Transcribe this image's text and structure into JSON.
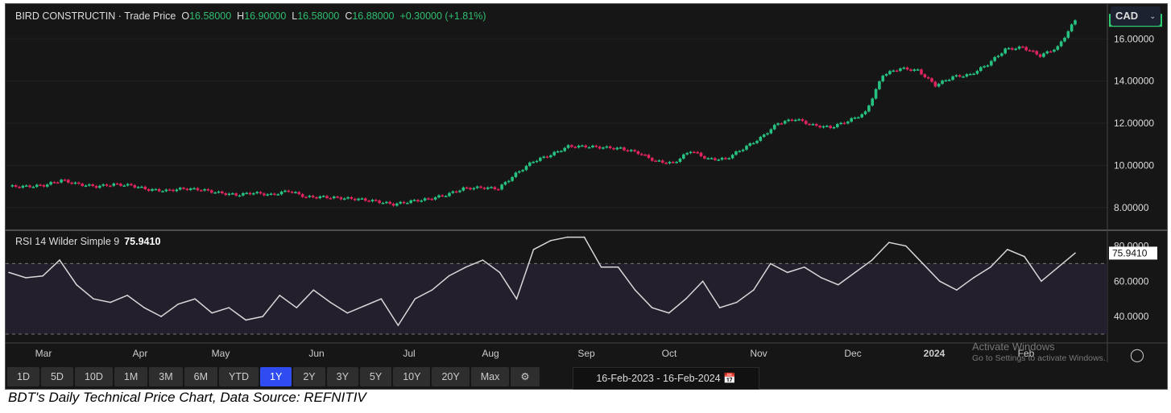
{
  "header": {
    "symbol": "BIRD CONSTRUCTIN",
    "sep": "·",
    "series": "Trade Price",
    "o_label": "O",
    "o": "16.58000",
    "h_label": "H",
    "h": "16.90000",
    "l_label": "L",
    "l": "16.58000",
    "c_label": "C",
    "c": "16.88000",
    "change": "+0.30000 (+1.81%)"
  },
  "currency": "CAD",
  "rsi_header": {
    "label": "RSI 14 Wilder Simple 9",
    "value": "75.9410"
  },
  "ranges": [
    "1D",
    "5D",
    "10D",
    "1M",
    "3M",
    "6M",
    "YTD",
    "1Y",
    "2Y",
    "3Y",
    "5Y",
    "10Y",
    "20Y",
    "Max"
  ],
  "active_range": "1Y",
  "date_range": {
    "from": "16-Feb-2023",
    "sep": "-",
    "to": "16-Feb-2024"
  },
  "watermark": {
    "line1": "Activate Windows",
    "line2": "Go to Settings to activate Windows."
  },
  "caption": "BDT's Daily Technical Price Chart, Data Source: REFNITIV",
  "colors": {
    "up": "#26c281",
    "down": "#e0245e",
    "rsi": "#d8d8d8",
    "last_price_bg": "#2ecc71"
  },
  "chart_data": [
    {
      "type": "candlestick",
      "title": "BIRD CONSTRUCTIN - Trade Price",
      "ylim": [
        7,
        17.5
      ],
      "yticks": [
        "8.00000",
        "10.00000",
        "12.00000",
        "14.00000",
        "16.00000"
      ],
      "ytick_values": [
        8,
        10,
        12,
        14,
        16
      ],
      "last_price": "16.88000",
      "last_value": 16.88,
      "xticks": [
        "Mar",
        "Apr",
        "May",
        "Jun",
        "Jul",
        "Aug",
        "Sep",
        "Oct",
        "Nov",
        "Dec",
        "2024",
        "Feb"
      ],
      "weekly_close": [
        9.0,
        9.0,
        9.05,
        9.3,
        9.1,
        9.0,
        9.1,
        9.05,
        8.85,
        8.8,
        8.9,
        8.85,
        8.7,
        8.6,
        8.7,
        8.6,
        8.8,
        8.5,
        8.5,
        8.45,
        8.4,
        8.3,
        8.15,
        8.3,
        8.4,
        8.6,
        8.9,
        8.95,
        8.9,
        9.6,
        10.2,
        10.5,
        10.9,
        10.9,
        10.85,
        10.8,
        10.6,
        10.2,
        10.1,
        10.7,
        10.3,
        10.3,
        10.8,
        11.3,
        12.0,
        12.2,
        11.9,
        11.8,
        12.1,
        12.5,
        14.3,
        14.6,
        14.5,
        13.8,
        14.2,
        14.3,
        14.8,
        15.5,
        15.6,
        15.2,
        15.6,
        16.88
      ]
    },
    {
      "type": "line",
      "title": "RSI 14 Wilder Simple 9",
      "ylim": [
        25,
        88
      ],
      "yticks": [
        "40.0000",
        "60.0000",
        "80.0000"
      ],
      "ytick_values": [
        40,
        60,
        80
      ],
      "levels": [
        30,
        70
      ],
      "last_value_label": "75.9410",
      "last_value": 75.941,
      "values": [
        65,
        62,
        63,
        72,
        58,
        50,
        48,
        52,
        45,
        40,
        47,
        50,
        42,
        45,
        38,
        40,
        52,
        45,
        55,
        48,
        42,
        46,
        50,
        35,
        50,
        55,
        63,
        68,
        72,
        65,
        50,
        78,
        83,
        85,
        85,
        68,
        68,
        55,
        45,
        42,
        50,
        60,
        45,
        48,
        55,
        70,
        65,
        68,
        62,
        58,
        65,
        72,
        82,
        80,
        70,
        60,
        55,
        62,
        68,
        78,
        74,
        60,
        68,
        76
      ]
    }
  ]
}
